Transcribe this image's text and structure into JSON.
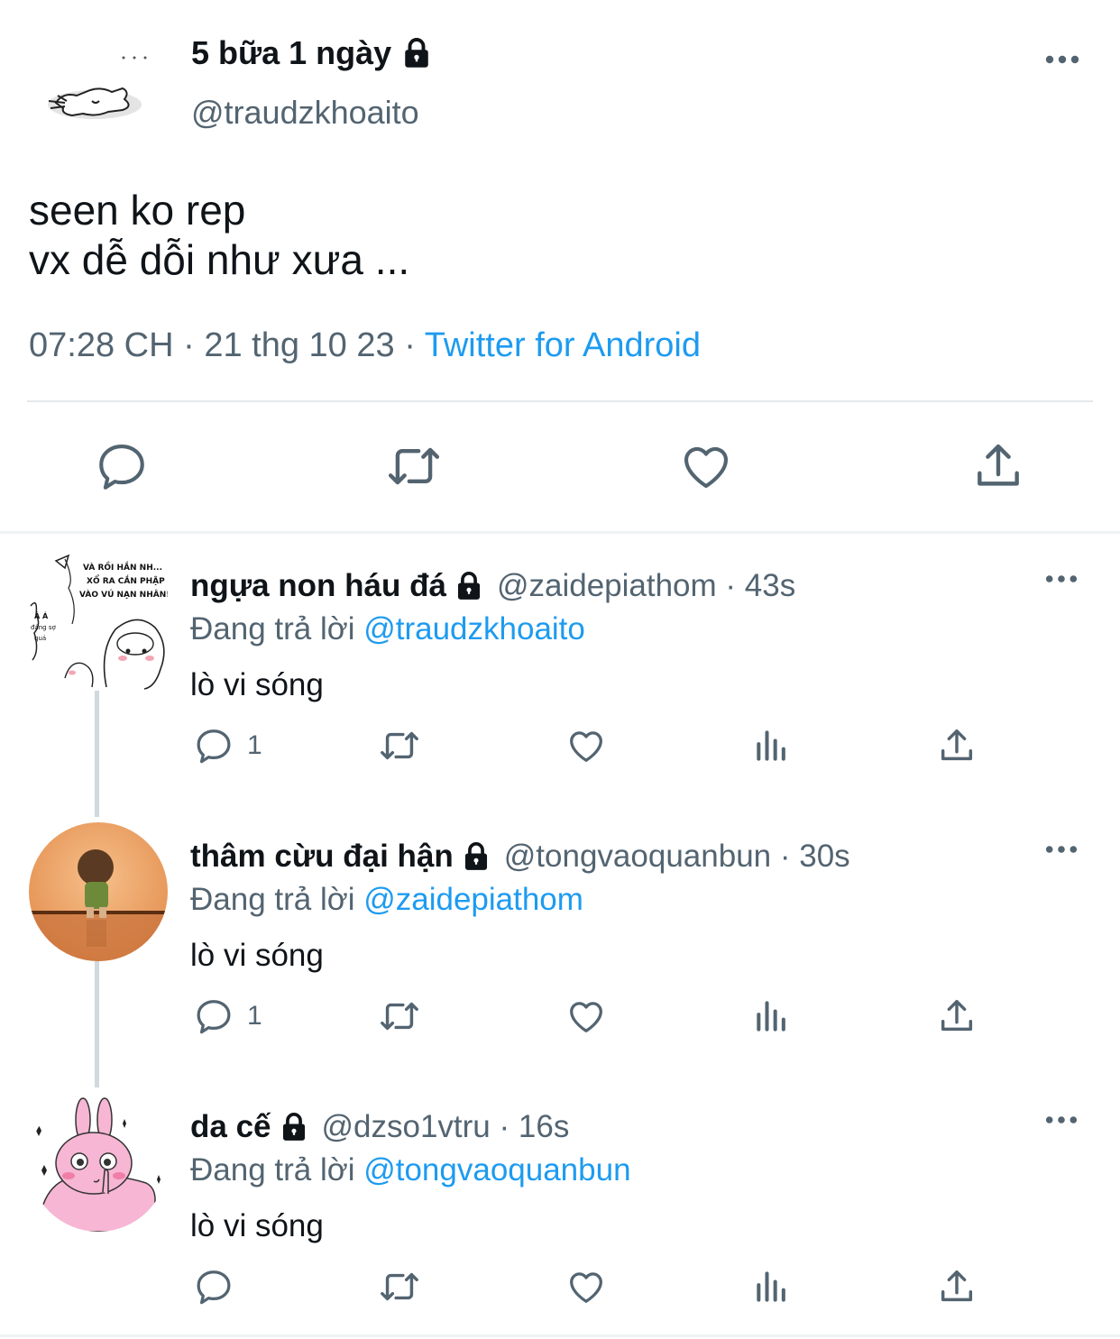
{
  "main_tweet": {
    "display_name": "5 bữa 1 ngày",
    "handle": "@traudzkhoaito",
    "text_lines": [
      "seen ko rep",
      "vx dễ dỗi như xưa ..."
    ],
    "time": "07:28 CH",
    "date": "21 thg 10 23",
    "source": "Twitter for Android",
    "separator": "·"
  },
  "replies": [
    {
      "display_name": "ngựa non háu đá",
      "handle": "@zaidepiathom",
      "age": "43s",
      "replying_label": "Đang trả lời",
      "replying_to": "@traudzkhoaito",
      "text": "lò vi sóng",
      "reply_count": "1",
      "avatar_texts": [
        "VÀ RỒI HẮN NH...",
        "XỔ RA CẮN PHẬP",
        "VÀO VÚ NẠN NHÂN!!",
        "Á Á",
        "đáng sợ",
        "quá"
      ]
    },
    {
      "display_name": "thâm cừu đại hận",
      "handle": "@tongvaoquanbun",
      "age": "30s",
      "replying_label": "Đang trả lời",
      "replying_to": "@zaidepiathom",
      "text": "lò vi sóng",
      "reply_count": "1"
    },
    {
      "display_name": "da cế",
      "handle": "@dzso1vtru",
      "age": "16s",
      "replying_label": "Đang trả lời",
      "replying_to": "@tongvaoquanbun",
      "text": "lò vi sóng",
      "reply_count": ""
    }
  ],
  "colors": {
    "accent": "#1d9bf0",
    "secondary_text": "#536471",
    "primary_text": "#0f1419",
    "divider": "#eff3f4"
  },
  "icons": [
    "lock-icon",
    "more-icon",
    "reply-icon",
    "retweet-icon",
    "like-icon",
    "views-icon",
    "share-icon"
  ]
}
